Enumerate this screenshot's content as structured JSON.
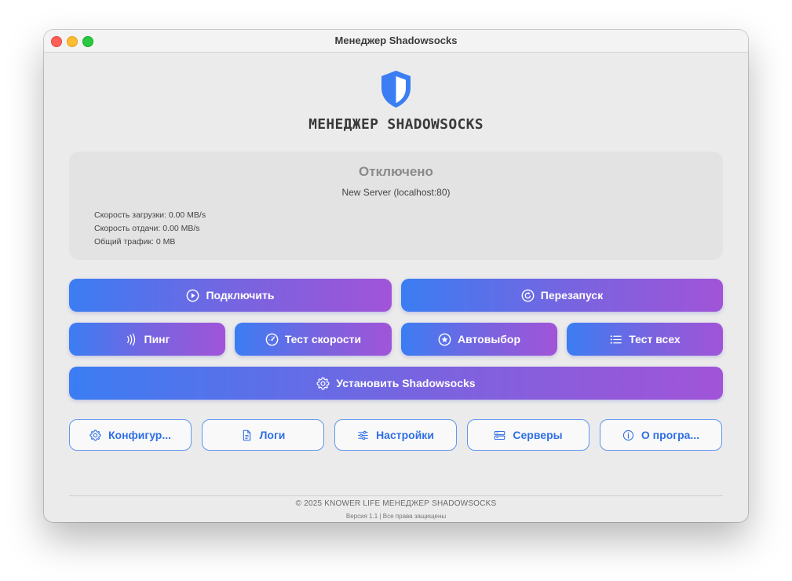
{
  "window": {
    "title": "Менеджер Shadowsocks"
  },
  "header": {
    "app_title": "МЕНЕДЖЕР SHADOWSOCKS"
  },
  "status": {
    "state": "Отключено",
    "server": "New Server (localhost:80)",
    "download_speed": "Скорость загрузки: 0.00 MB/s",
    "upload_speed": "Скорость отдачи: 0.00 MB/s",
    "total_traffic": "Общий трафик: 0 MB"
  },
  "actions": {
    "connect": "Подключить",
    "restart": "Перезапуск",
    "ping": "Пинг",
    "speed_test": "Тест скорости",
    "auto_select": "Автовыбор",
    "test_all": "Тест всех",
    "install": "Установить Shadowsocks"
  },
  "nav": {
    "config": "Конфигур...",
    "logs": "Логи",
    "settings": "Настройки",
    "servers": "Серверы",
    "about": "О програ..."
  },
  "footer": {
    "copyright": "© 2025 KNOWER LIFE МЕНЕДЖЕР SHADOWSOCKS",
    "version": "Версия 1.1 | Все права защищены"
  },
  "colors": {
    "accent_blue": "#3b7df3",
    "accent_purple": "#a154d8",
    "outline_blue": "#2f6fe6",
    "status_gray": "#8a8a8a"
  },
  "icons": {
    "logo": "shield-icon",
    "connect": "play-circle-icon",
    "restart": "refresh-circle-icon",
    "ping": "signal-waves-icon",
    "speed_test": "gauge-icon",
    "auto_select": "star-circle-icon",
    "test_all": "list-icon",
    "install": "gear-icon",
    "config": "gear-icon",
    "logs": "document-icon",
    "settings": "sliders-icon",
    "servers": "server-icon",
    "about": "info-icon"
  }
}
